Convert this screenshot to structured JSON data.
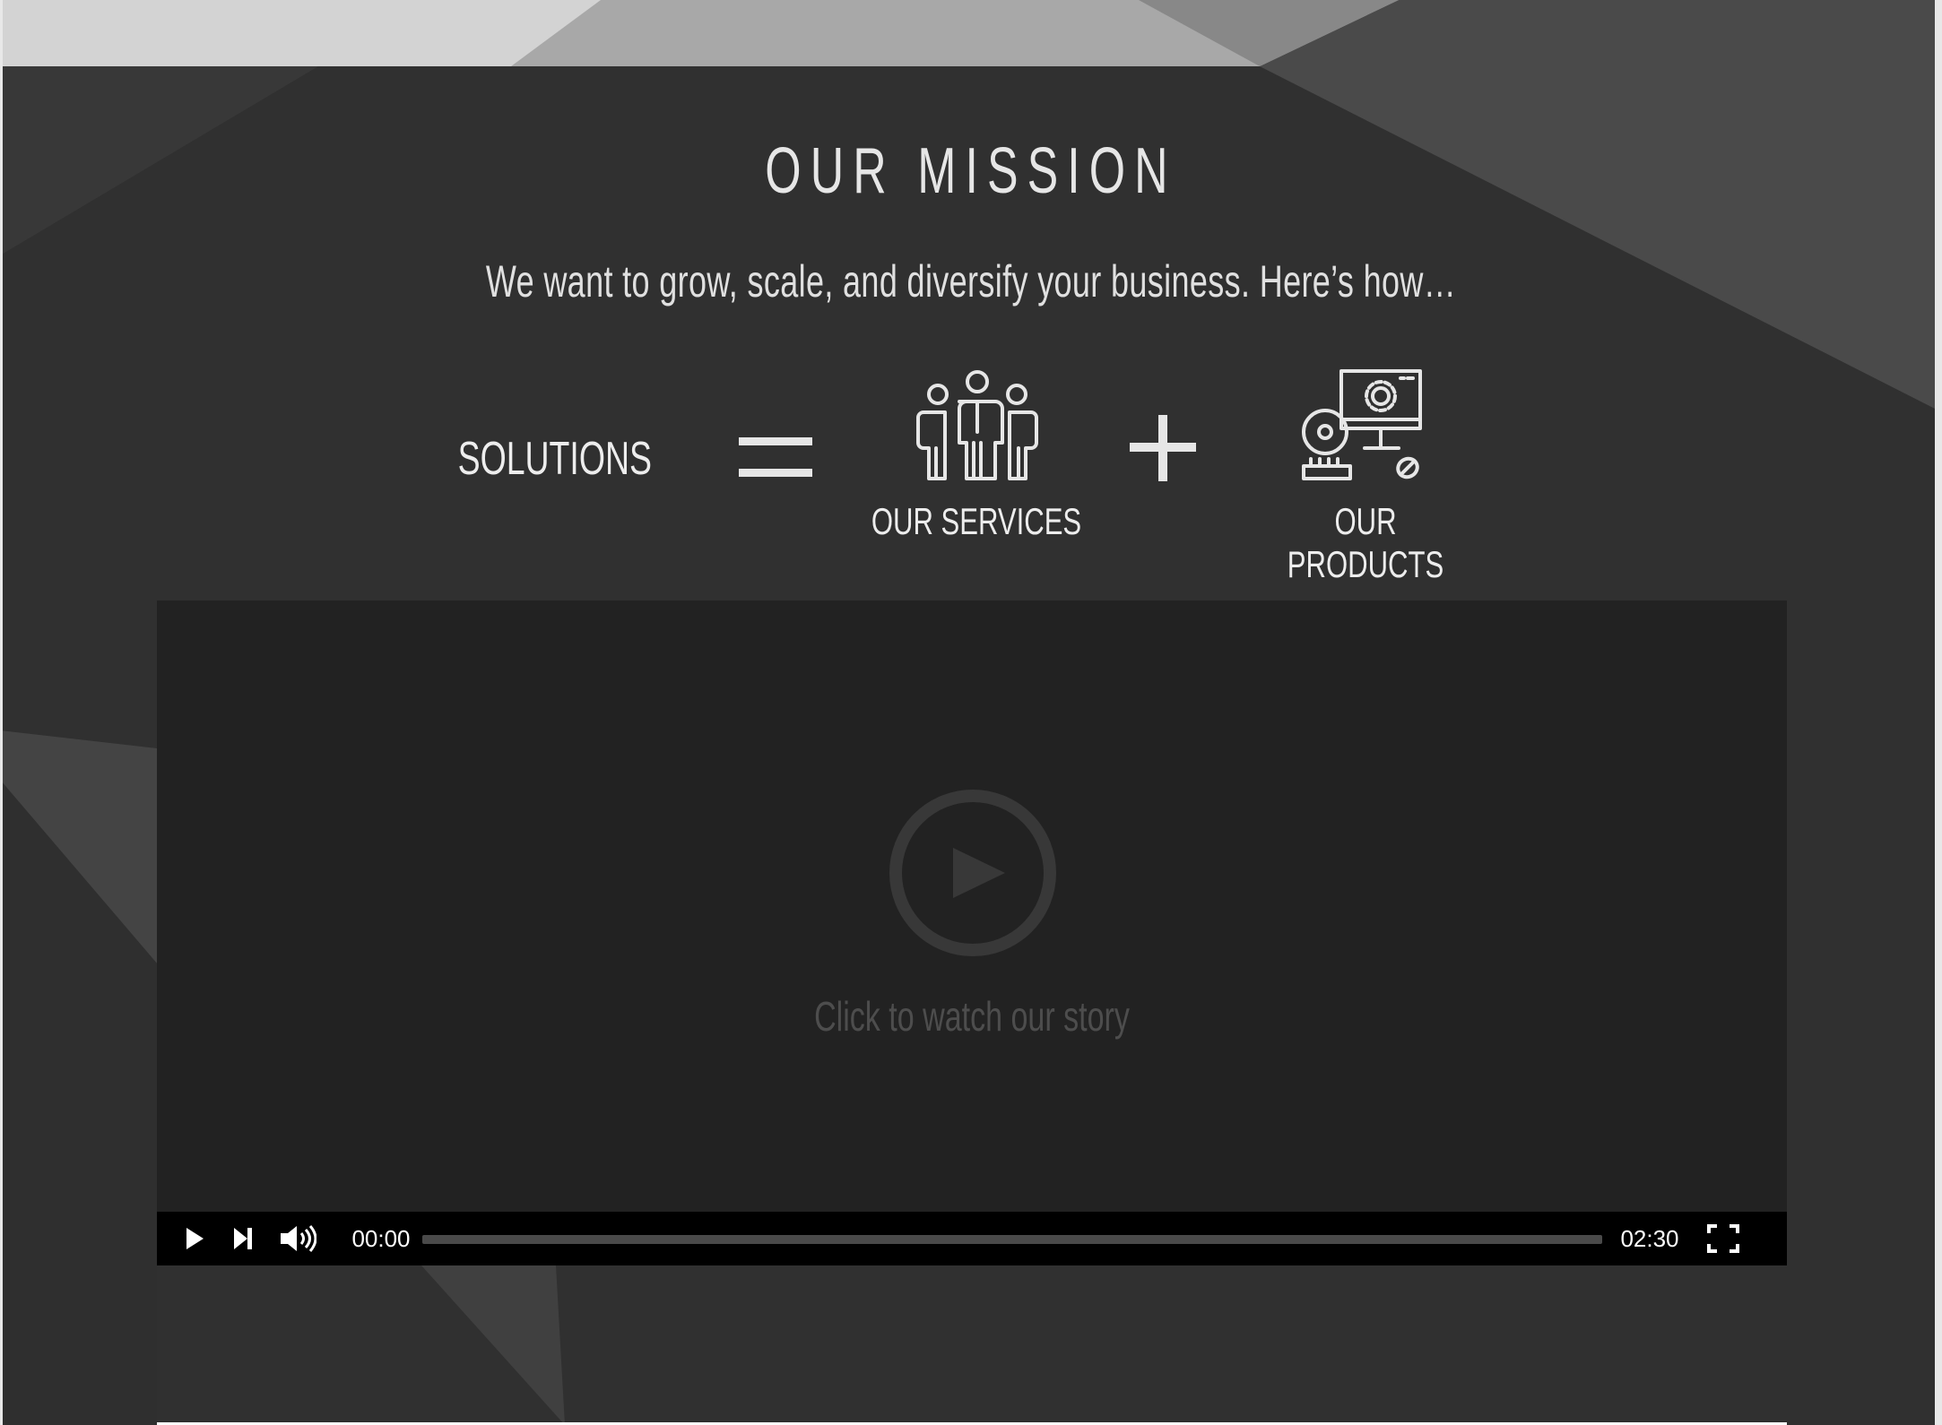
{
  "mission": {
    "title": "OUR MISSION",
    "subtitle": "We want to grow, scale, and diversify your business. Here’s how…"
  },
  "equation": {
    "left_label": "SOLUTIONS",
    "equals_icon": "equals-sign",
    "plus_icon": "plus-sign",
    "services": {
      "icon": "team-people-icon",
      "label": "OUR SERVICES"
    },
    "products": {
      "icon": "computer-settings-icon",
      "label": "OUR PRODUCTS"
    }
  },
  "video": {
    "caption": "Click to watch our story",
    "current_time": "00:00",
    "duration": "02:30",
    "progress": 0,
    "controls": [
      "play-icon",
      "skip-next-icon",
      "volume-icon",
      "fullscreen-icon"
    ]
  },
  "colors": {
    "background": "#303030",
    "text": "#e6e6e6",
    "video_bg": "#222222",
    "control_bar": "#000000"
  }
}
